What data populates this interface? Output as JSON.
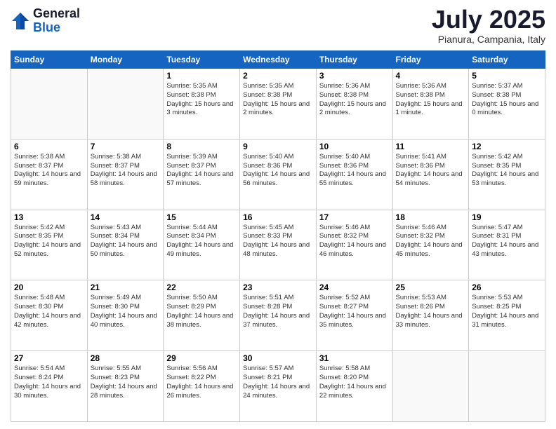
{
  "header": {
    "logo_general": "General",
    "logo_blue": "Blue",
    "month": "July 2025",
    "location": "Pianura, Campania, Italy"
  },
  "weekdays": [
    "Sunday",
    "Monday",
    "Tuesday",
    "Wednesday",
    "Thursday",
    "Friday",
    "Saturday"
  ],
  "weeks": [
    [
      {
        "day": "",
        "sunrise": "",
        "sunset": "",
        "daylight": ""
      },
      {
        "day": "",
        "sunrise": "",
        "sunset": "",
        "daylight": ""
      },
      {
        "day": "1",
        "sunrise": "Sunrise: 5:35 AM",
        "sunset": "Sunset: 8:38 PM",
        "daylight": "Daylight: 15 hours and 3 minutes."
      },
      {
        "day": "2",
        "sunrise": "Sunrise: 5:35 AM",
        "sunset": "Sunset: 8:38 PM",
        "daylight": "Daylight: 15 hours and 2 minutes."
      },
      {
        "day": "3",
        "sunrise": "Sunrise: 5:36 AM",
        "sunset": "Sunset: 8:38 PM",
        "daylight": "Daylight: 15 hours and 2 minutes."
      },
      {
        "day": "4",
        "sunrise": "Sunrise: 5:36 AM",
        "sunset": "Sunset: 8:38 PM",
        "daylight": "Daylight: 15 hours and 1 minute."
      },
      {
        "day": "5",
        "sunrise": "Sunrise: 5:37 AM",
        "sunset": "Sunset: 8:38 PM",
        "daylight": "Daylight: 15 hours and 0 minutes."
      }
    ],
    [
      {
        "day": "6",
        "sunrise": "Sunrise: 5:38 AM",
        "sunset": "Sunset: 8:37 PM",
        "daylight": "Daylight: 14 hours and 59 minutes."
      },
      {
        "day": "7",
        "sunrise": "Sunrise: 5:38 AM",
        "sunset": "Sunset: 8:37 PM",
        "daylight": "Daylight: 14 hours and 58 minutes."
      },
      {
        "day": "8",
        "sunrise": "Sunrise: 5:39 AM",
        "sunset": "Sunset: 8:37 PM",
        "daylight": "Daylight: 14 hours and 57 minutes."
      },
      {
        "day": "9",
        "sunrise": "Sunrise: 5:40 AM",
        "sunset": "Sunset: 8:36 PM",
        "daylight": "Daylight: 14 hours and 56 minutes."
      },
      {
        "day": "10",
        "sunrise": "Sunrise: 5:40 AM",
        "sunset": "Sunset: 8:36 PM",
        "daylight": "Daylight: 14 hours and 55 minutes."
      },
      {
        "day": "11",
        "sunrise": "Sunrise: 5:41 AM",
        "sunset": "Sunset: 8:36 PM",
        "daylight": "Daylight: 14 hours and 54 minutes."
      },
      {
        "day": "12",
        "sunrise": "Sunrise: 5:42 AM",
        "sunset": "Sunset: 8:35 PM",
        "daylight": "Daylight: 14 hours and 53 minutes."
      }
    ],
    [
      {
        "day": "13",
        "sunrise": "Sunrise: 5:42 AM",
        "sunset": "Sunset: 8:35 PM",
        "daylight": "Daylight: 14 hours and 52 minutes."
      },
      {
        "day": "14",
        "sunrise": "Sunrise: 5:43 AM",
        "sunset": "Sunset: 8:34 PM",
        "daylight": "Daylight: 14 hours and 50 minutes."
      },
      {
        "day": "15",
        "sunrise": "Sunrise: 5:44 AM",
        "sunset": "Sunset: 8:34 PM",
        "daylight": "Daylight: 14 hours and 49 minutes."
      },
      {
        "day": "16",
        "sunrise": "Sunrise: 5:45 AM",
        "sunset": "Sunset: 8:33 PM",
        "daylight": "Daylight: 14 hours and 48 minutes."
      },
      {
        "day": "17",
        "sunrise": "Sunrise: 5:46 AM",
        "sunset": "Sunset: 8:32 PM",
        "daylight": "Daylight: 14 hours and 46 minutes."
      },
      {
        "day": "18",
        "sunrise": "Sunrise: 5:46 AM",
        "sunset": "Sunset: 8:32 PM",
        "daylight": "Daylight: 14 hours and 45 minutes."
      },
      {
        "day": "19",
        "sunrise": "Sunrise: 5:47 AM",
        "sunset": "Sunset: 8:31 PM",
        "daylight": "Daylight: 14 hours and 43 minutes."
      }
    ],
    [
      {
        "day": "20",
        "sunrise": "Sunrise: 5:48 AM",
        "sunset": "Sunset: 8:30 PM",
        "daylight": "Daylight: 14 hours and 42 minutes."
      },
      {
        "day": "21",
        "sunrise": "Sunrise: 5:49 AM",
        "sunset": "Sunset: 8:30 PM",
        "daylight": "Daylight: 14 hours and 40 minutes."
      },
      {
        "day": "22",
        "sunrise": "Sunrise: 5:50 AM",
        "sunset": "Sunset: 8:29 PM",
        "daylight": "Daylight: 14 hours and 38 minutes."
      },
      {
        "day": "23",
        "sunrise": "Sunrise: 5:51 AM",
        "sunset": "Sunset: 8:28 PM",
        "daylight": "Daylight: 14 hours and 37 minutes."
      },
      {
        "day": "24",
        "sunrise": "Sunrise: 5:52 AM",
        "sunset": "Sunset: 8:27 PM",
        "daylight": "Daylight: 14 hours and 35 minutes."
      },
      {
        "day": "25",
        "sunrise": "Sunrise: 5:53 AM",
        "sunset": "Sunset: 8:26 PM",
        "daylight": "Daylight: 14 hours and 33 minutes."
      },
      {
        "day": "26",
        "sunrise": "Sunrise: 5:53 AM",
        "sunset": "Sunset: 8:25 PM",
        "daylight": "Daylight: 14 hours and 31 minutes."
      }
    ],
    [
      {
        "day": "27",
        "sunrise": "Sunrise: 5:54 AM",
        "sunset": "Sunset: 8:24 PM",
        "daylight": "Daylight: 14 hours and 30 minutes."
      },
      {
        "day": "28",
        "sunrise": "Sunrise: 5:55 AM",
        "sunset": "Sunset: 8:23 PM",
        "daylight": "Daylight: 14 hours and 28 minutes."
      },
      {
        "day": "29",
        "sunrise": "Sunrise: 5:56 AM",
        "sunset": "Sunset: 8:22 PM",
        "daylight": "Daylight: 14 hours and 26 minutes."
      },
      {
        "day": "30",
        "sunrise": "Sunrise: 5:57 AM",
        "sunset": "Sunset: 8:21 PM",
        "daylight": "Daylight: 14 hours and 24 minutes."
      },
      {
        "day": "31",
        "sunrise": "Sunrise: 5:58 AM",
        "sunset": "Sunset: 8:20 PM",
        "daylight": "Daylight: 14 hours and 22 minutes."
      },
      {
        "day": "",
        "sunrise": "",
        "sunset": "",
        "daylight": ""
      },
      {
        "day": "",
        "sunrise": "",
        "sunset": "",
        "daylight": ""
      }
    ]
  ]
}
